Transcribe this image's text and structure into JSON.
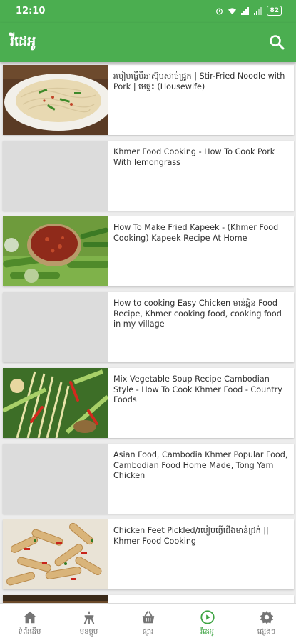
{
  "status_bar": {
    "time": "12:10",
    "battery": "82"
  },
  "app_bar": {
    "title": "វីដេអូ"
  },
  "videos": [
    {
      "title": "របៀបធ្វើមីឆាស៊ុបសាច់ជ្រូក | Stir-Fried Noodle with Pork | មេផ្ទះ (Housewife)",
      "thumbnail": "stir-fried-noodles"
    },
    {
      "title": "Khmer Food Cooking - How To Cook Pork With lemongrass",
      "thumbnail": "placeholder"
    },
    {
      "title": "How To Make Fried Kapeek  - (Khmer Food Cooking) Kapeek Recipe At Home",
      "thumbnail": "kapeek-dip"
    },
    {
      "title": "How to cooking Easy Chicken មាន់ឆ្អិន Food Recipe, Khmer cooking food, cooking food in my village",
      "thumbnail": "placeholder"
    },
    {
      "title": "Mix Vegetable Soup Recipe Cambodian Style - How To Cook Khmer Food - Country Foods",
      "thumbnail": "vegetable-soup"
    },
    {
      "title": "Asian Food, Cambodia Khmer Popular Food, Cambodian Food Home Made, Tong Yam Chicken",
      "thumbnail": "placeholder"
    },
    {
      "title": "Chicken Feet Pickled/របៀបធ្វើជើងមាន់ជ្រក់ || Khmer Food Cooking",
      "thumbnail": "chicken-feet"
    }
  ],
  "bottom_nav": [
    {
      "label": "ទំព័រដើម",
      "icon": "home-icon"
    },
    {
      "label": "មុខម្ហូប",
      "icon": "grill-icon"
    },
    {
      "label": "ផ្សារ",
      "icon": "basket-icon"
    },
    {
      "label": "វីដេអូ",
      "icon": "play-circle-icon",
      "active": true
    },
    {
      "label": "ផ្សេងៗ",
      "icon": "gear-icon"
    }
  ],
  "colors": {
    "primary": "#4bae50",
    "active_nav": "#3ea443"
  }
}
